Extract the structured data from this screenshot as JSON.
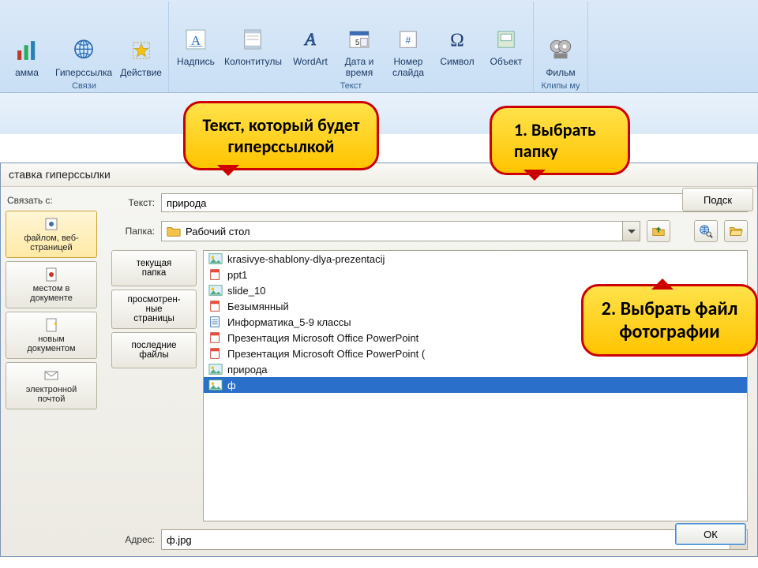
{
  "ribbon": {
    "groups": [
      {
        "label": "Связи",
        "items": [
          {
            "name": "chart-button",
            "label": "амма",
            "icon": "chart"
          },
          {
            "name": "hyperlink-button",
            "label": "Гиперссылка",
            "icon": "globe"
          },
          {
            "name": "action-button",
            "label": "Действие",
            "icon": "star"
          }
        ]
      },
      {
        "label": "Текст",
        "items": [
          {
            "name": "textbox-button",
            "label": "Надпись",
            "icon": "textA"
          },
          {
            "name": "header-footer-button",
            "label": "Колонтитулы",
            "icon": "headerfooter"
          },
          {
            "name": "wordart-button",
            "label": "WordArt",
            "icon": "wordart"
          },
          {
            "name": "date-time-button",
            "label": "Дата и\nвремя",
            "icon": "datetime"
          },
          {
            "name": "slide-number-button",
            "label": "Номер\nслайда",
            "icon": "slidenum"
          },
          {
            "name": "symbol-button",
            "label": "Символ",
            "icon": "omega"
          },
          {
            "name": "object-button",
            "label": "Объект",
            "icon": "object"
          }
        ]
      },
      {
        "label": "Клипы му",
        "items": [
          {
            "name": "movie-button",
            "label": "Фильм",
            "icon": "film"
          }
        ]
      }
    ]
  },
  "dialog": {
    "title": "ставка гиперссылки",
    "link_label": "Связать с:",
    "text_label": "Текст:",
    "text_value": "природа",
    "folder_label": "Папка:",
    "folder_value": "Рабочий стол",
    "address_label": "Адрес:",
    "address_value": "ф.jpg",
    "hint_button": "Подск",
    "ok": "ОК",
    "left_nav": [
      {
        "name": "link-file-web",
        "label": "файлом, веб-\nстраницей",
        "selected": true
      },
      {
        "name": "link-place-doc",
        "label": "местом в\nдокументе"
      },
      {
        "name": "link-new-doc",
        "label": "новым\nдокументом"
      },
      {
        "name": "link-email",
        "label": "электронной\nпочтой"
      }
    ],
    "sub_nav": [
      {
        "name": "current-folder",
        "label": "текущая\nпапка"
      },
      {
        "name": "browsed-pages",
        "label": "просмотрен-\nные\nстраницы"
      },
      {
        "name": "recent-files",
        "label": "последние\nфайлы"
      }
    ],
    "files": [
      {
        "icon": "img",
        "label": "krasivye-shablony-dlya-prezentacij"
      },
      {
        "icon": "ppt",
        "label": "ppt1"
      },
      {
        "icon": "img",
        "label": "slide_10"
      },
      {
        "icon": "ppt",
        "label": "Безымянный"
      },
      {
        "icon": "doc",
        "label": "Информатика_5-9 классы"
      },
      {
        "icon": "ppt",
        "label": "Презентация Microsoft Office PowerPoint"
      },
      {
        "icon": "ppt",
        "label": "Презентация Microsoft Office PowerPoint ("
      },
      {
        "icon": "img",
        "label": "природа"
      },
      {
        "icon": "img",
        "label": "ф",
        "selected": true
      }
    ]
  },
  "callouts": {
    "c1": "Текст, который будет гиперссылкой",
    "c2": "1. Выбрать папку",
    "c3": "2. Выбрать файл фотографии"
  }
}
